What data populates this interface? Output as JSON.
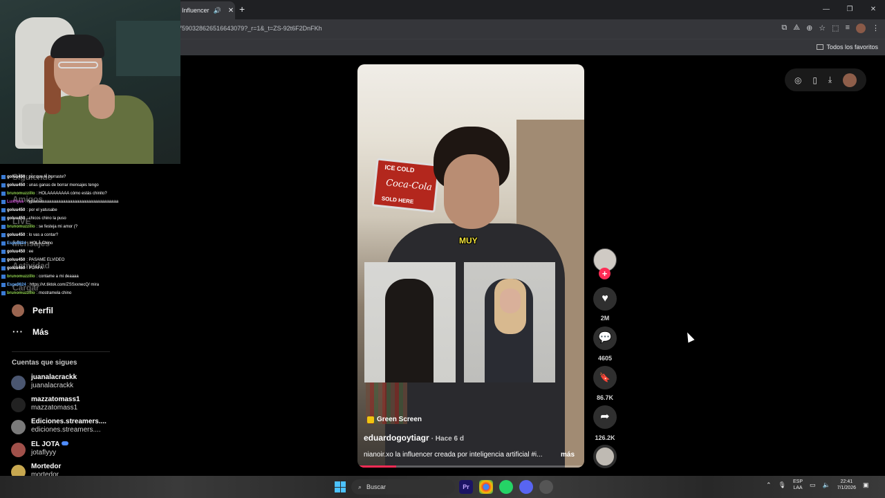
{
  "browser": {
    "tab_title": "Influencer",
    "url": "7590328626516643079?_r=1&_t=ZS-92t6F2DnFKh",
    "bookmarks_label": "Todos los favoritos",
    "window_buttons": [
      "—",
      "❐",
      "✕"
    ]
  },
  "chat": [
    {
      "user": "goluu450",
      "text": ": por que le borraste?",
      "color": "#ffffff"
    },
    {
      "user": "goluu450",
      "text": ": unas ganas de borrar mensajes tengo",
      "color": "#ffffff"
    },
    {
      "user": "brunomuzzillo",
      "text": ": HOLAAAAAAAA cómo estás chinito?",
      "color": "#8fd14f"
    },
    {
      "user": "Luxhyss",
      "text": ": holaaaaaaaaaaaaaaaaaaaaaaaaaaaaaaaaaaaaa",
      "color": "#d04fd8"
    },
    {
      "user": "goluu450",
      "text": ": por el yatusabe",
      "color": "#ffffff"
    },
    {
      "user": "goluu450",
      "text": ": chicos chino la puso",
      "color": "#ffffff"
    },
    {
      "user": "brunomuzzillo",
      "text": ": se festeja mi amor (?",
      "color": "#8fd14f"
    },
    {
      "user": "goluu450",
      "text": ": lo vas a contar?",
      "color": "#ffffff"
    },
    {
      "user": "Espe9824",
      "text": ": HOLA Chino",
      "color": "#6ab0ff"
    },
    {
      "user": "goluu450",
      "text": ": ee",
      "color": "#ffffff"
    },
    {
      "user": "goluu450",
      "text": ": PASAME ELVIDEO",
      "color": "#ffffff"
    },
    {
      "user": "goluu450",
      "text": ": PORFA",
      "color": "#ffffff"
    },
    {
      "user": "brunomuzzillo",
      "text": ": contame a mi deaaaa",
      "color": "#8fd14f"
    },
    {
      "user": "Espe9824",
      "text": ": https://vt.tiktok.com/ZSSxxnecQ/ mira",
      "color": "#6ab0ff"
    },
    {
      "user": "brunomuzzillo",
      "text": ": mostramela chino",
      "color": "#8fd14f"
    }
  ],
  "sidebar": {
    "ghost_items": [
      "Siguiendo",
      "Amigos",
      "LIVE",
      "Mensajes",
      "Actividad",
      "Cargar"
    ],
    "profile_label": "Perfil",
    "more_label": "Más",
    "following_title": "Cuentas que sigues",
    "accounts": [
      {
        "name": "juanalacrackk",
        "handle": "juanalacrackk",
        "avatar_color": "#4a5670",
        "verified": false
      },
      {
        "name": "mazzatomass1",
        "handle": "mazzatomass1",
        "avatar_color": "#222222",
        "verified": false
      },
      {
        "name": "Ediciones.streamers....",
        "handle": "ediciones.streamers....",
        "avatar_color": "#7a7a7a",
        "verified": false
      },
      {
        "name": "EL JOTA",
        "handle": "jotaflyyy",
        "avatar_color": "#a0504a",
        "verified": true
      },
      {
        "name": "Mortedor",
        "handle": "mortedor",
        "avatar_color": "#c8a850",
        "verified": false
      }
    ]
  },
  "video": {
    "overlay_word": "MUY",
    "sign_lines": [
      "ICE COLD",
      "Coca-Cola",
      "SOLD HERE"
    ],
    "effect_label": "Green Screen",
    "author": "eduardogoytiagr",
    "posted_ago": "· Hace 6 d",
    "description": "nianoir.xo la influencer creada por inteligencia artificial #i...",
    "more_label": "más",
    "progress": 0.17
  },
  "actions": {
    "likes": "2M",
    "comments": "4605",
    "saves": "86.7K",
    "shares": "126.2K"
  },
  "taskbar": {
    "search_placeholder": "Buscar",
    "lang_top": "ESP",
    "lang_bottom": "LAA",
    "time": "22:41",
    "date": "7/1/2026"
  },
  "colors": {
    "accent": "#fe2c55",
    "chrome_dark": "#1f2023",
    "chrome_toolbar": "#35363a"
  }
}
